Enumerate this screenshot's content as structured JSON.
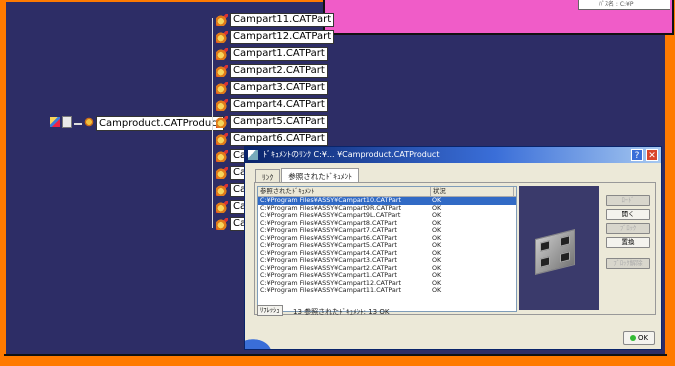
{
  "pink_window": {
    "snippet": "ﾊﾟｽ名 : C:¥P"
  },
  "tree": {
    "root_label": "Camproduct.CATProduct",
    "children": [
      "Campart11.CATPart",
      "Campart12.CATPart",
      "Campart1.CATPart",
      "Campart2.CATPart",
      "Campart3.CATPart",
      "Campart4.CATPart",
      "Campart5.CATPart",
      "Campart6.CATPart",
      "Ca",
      "Ca",
      "Ca",
      "Ca",
      "Ca"
    ]
  },
  "dialog": {
    "title": "ﾄﾞｷｭﾒﾝﾄのﾘﾝｸ C:¥... ¥Camproduct.CATProduct",
    "help_label": "?",
    "close_label": "✕",
    "tabs": [
      "ﾘﾝｸ",
      "参照されたﾄﾞｷｭﾒﾝﾄ"
    ],
    "columns": [
      "参照されたﾄﾞｷｭﾒﾝﾄ",
      "状況"
    ],
    "rows": [
      {
        "path": "C:¥Program Files¥ASSY¥Campart10.CATPart",
        "status": "OK"
      },
      {
        "path": "C:¥Program Files¥ASSY¥Campart9R.CATPart",
        "status": "OK"
      },
      {
        "path": "C:¥Program Files¥ASSY¥Campart9L.CATPart",
        "status": "OK"
      },
      {
        "path": "C:¥Program Files¥ASSY¥Campart8.CATPart",
        "status": "OK"
      },
      {
        "path": "C:¥Program Files¥ASSY¥Campart7.CATPart",
        "status": "OK"
      },
      {
        "path": "C:¥Program Files¥ASSY¥Campart6.CATPart",
        "status": "OK"
      },
      {
        "path": "C:¥Program Files¥ASSY¥Campart5.CATPart",
        "status": "OK"
      },
      {
        "path": "C:¥Program Files¥ASSY¥Campart4.CATPart",
        "status": "OK"
      },
      {
        "path": "C:¥Program Files¥ASSY¥Campart3.CATPart",
        "status": "OK"
      },
      {
        "path": "C:¥Program Files¥ASSY¥Campart2.CATPart",
        "status": "OK"
      },
      {
        "path": "C:¥Program Files¥ASSY¥Campart1.CATPart",
        "status": "OK"
      },
      {
        "path": "C:¥Program Files¥ASSY¥Campart12.CATPart",
        "status": "OK"
      },
      {
        "path": "C:¥Program Files¥ASSY¥Campart11.CATPart",
        "status": "OK"
      }
    ],
    "side_buttons": [
      {
        "label": "ﾛｰﾄﾞ",
        "enabled": false
      },
      {
        "label": "開く",
        "enabled": true
      },
      {
        "label": "ﾌﾞﾛｯｸ",
        "enabled": false
      },
      {
        "label": "置換",
        "enabled": true
      },
      {
        "label": "ﾌﾞﾛｯｸ解除",
        "enabled": false
      }
    ],
    "refresh_label": "ﾘﾌﾚｯｼｭ",
    "status_text": "13 参照されたﾄﾞｷｭﾒﾝﾄ: 13 OK",
    "ok_label": "OK"
  }
}
